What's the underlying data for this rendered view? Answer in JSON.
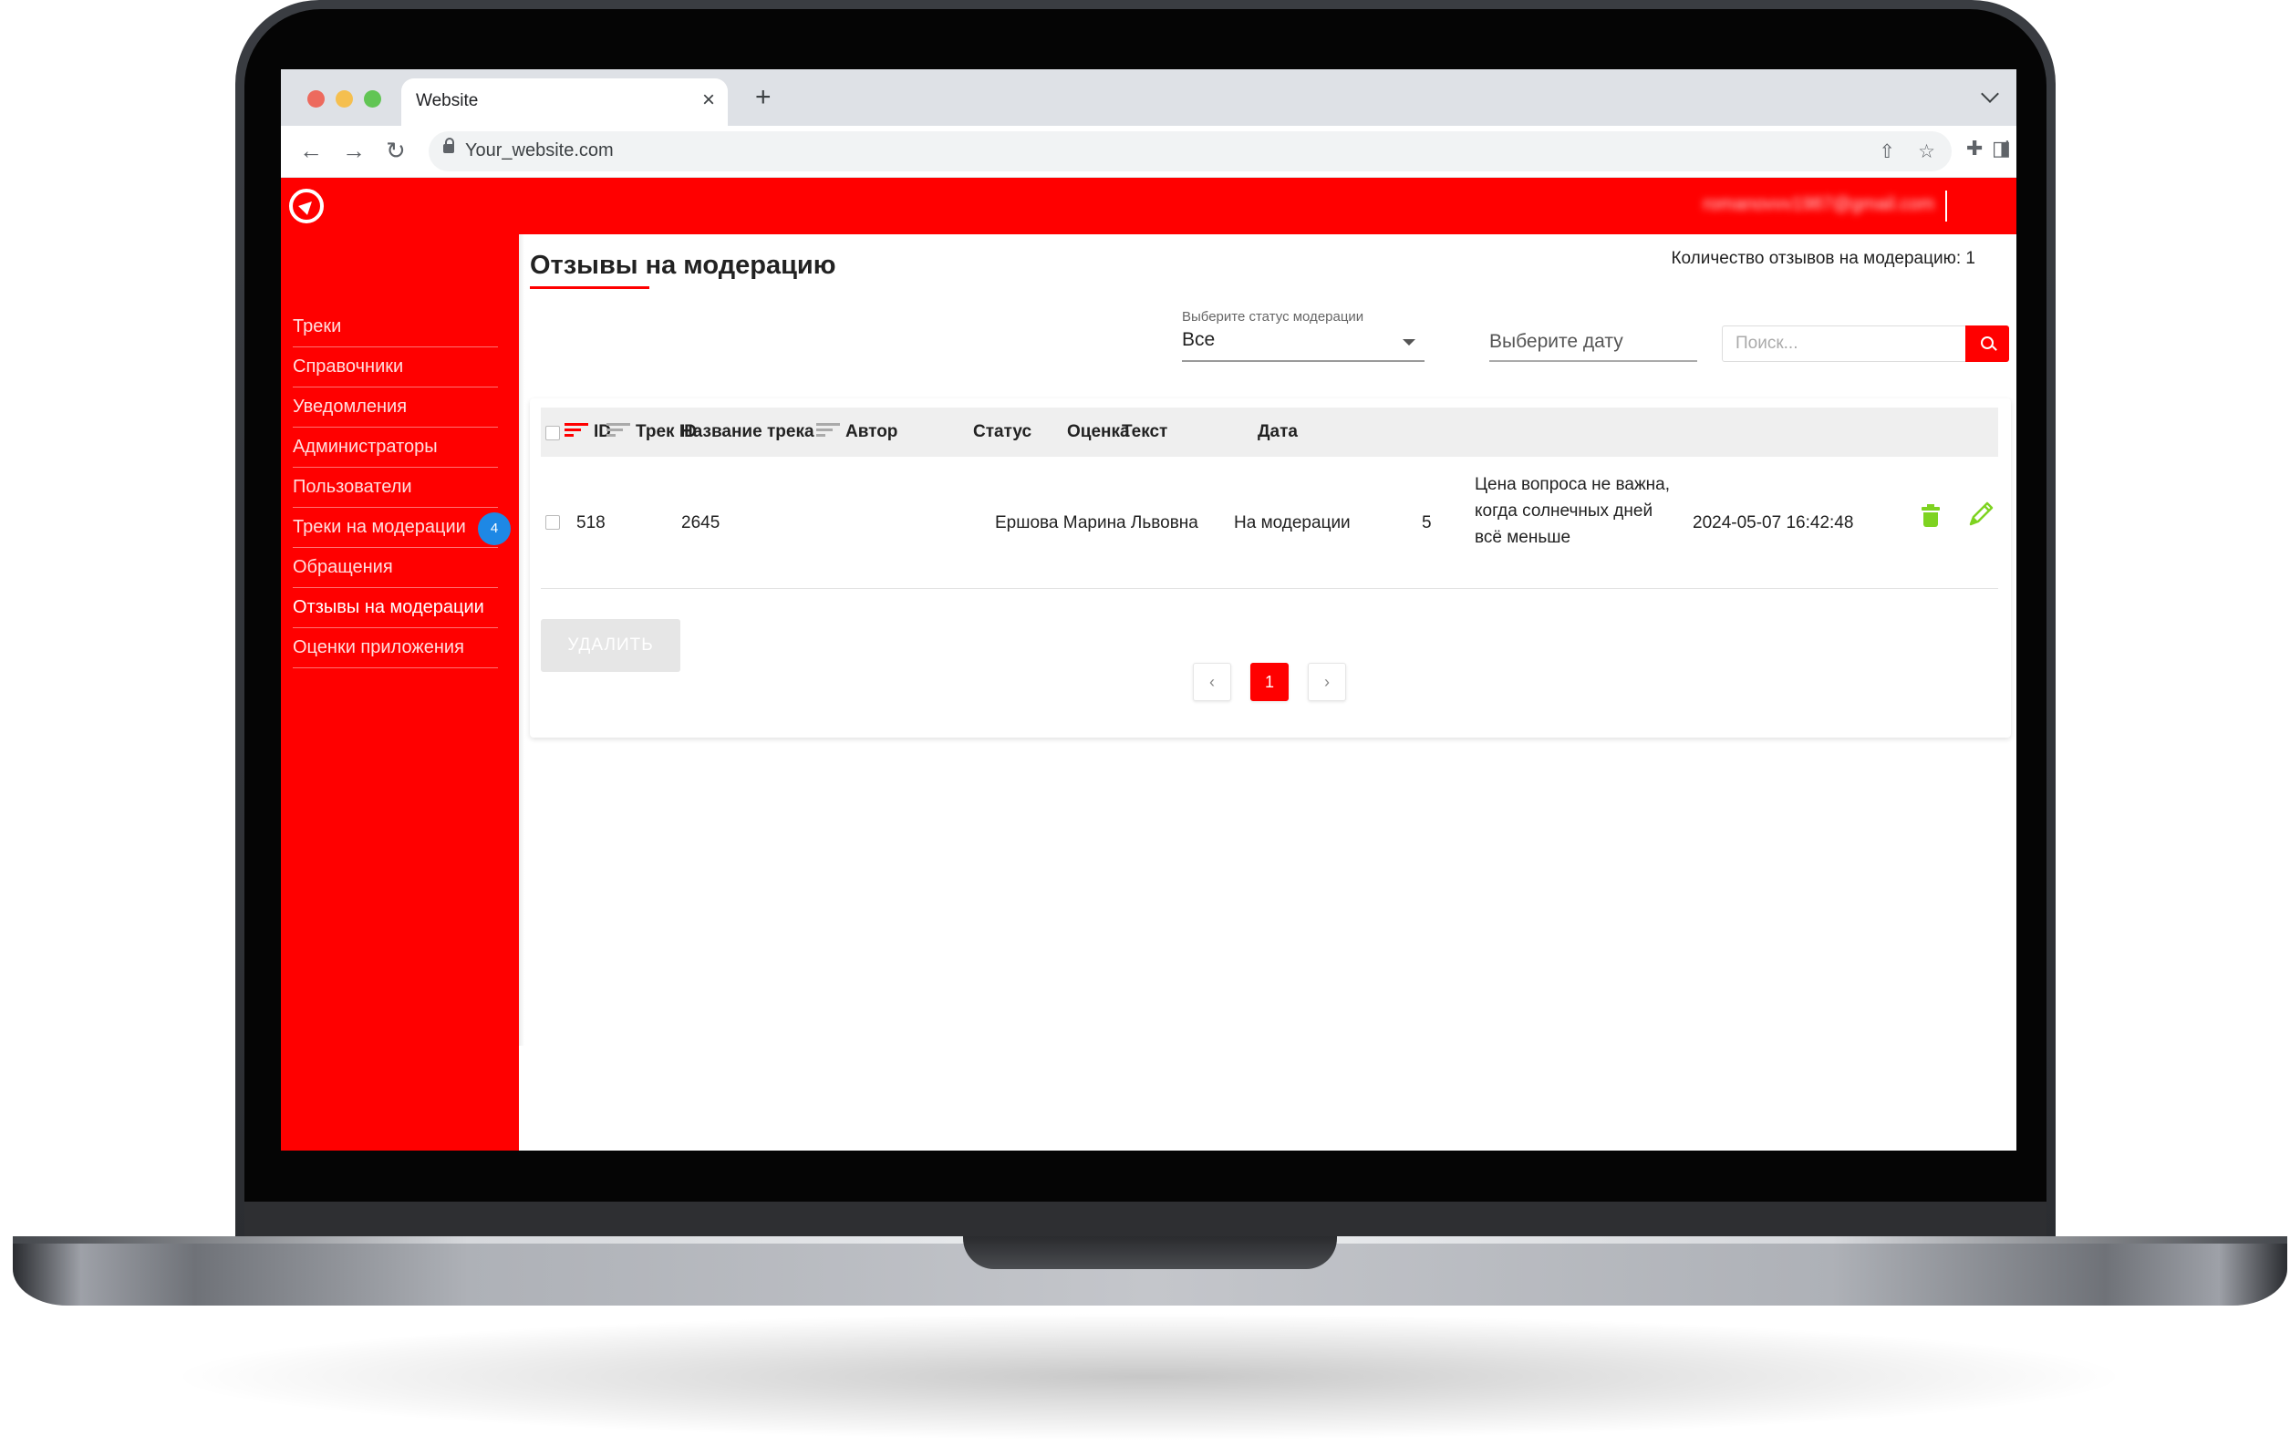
{
  "browser": {
    "tab_title": "Website",
    "tab_close": "×",
    "new_tab": "+",
    "url": "Your_website.com",
    "back": "←",
    "forward": "→",
    "reload": "↻",
    "share": "⇧",
    "star": "☆",
    "extensions": "✚",
    "sidepanel": "◨",
    "menu": "⋮"
  },
  "header": {
    "user_email": "romanovvv1987@gmail.com"
  },
  "sidebar": {
    "items": [
      {
        "label": "Треки"
      },
      {
        "label": "Справочники"
      },
      {
        "label": "Уведомления"
      },
      {
        "label": "Администраторы"
      },
      {
        "label": "Пользователи"
      },
      {
        "label": "Треки на модерации",
        "badge": "4"
      },
      {
        "label": "Обращения"
      },
      {
        "label": "Отзывы на модерации"
      },
      {
        "label": "Оценки приложения"
      }
    ],
    "active_index": 7
  },
  "page": {
    "title": "Отзывы на модерацию",
    "count_label": "Количество отзывов на модерацию: 1"
  },
  "filters": {
    "status_label": "Выберите статус модерации",
    "status_value": "Все",
    "date_placeholder": "Выберите дату",
    "search_placeholder": "Поиск..."
  },
  "table": {
    "columns": [
      "ID",
      "Трек ID",
      "Название трека",
      "Автор",
      "Статус",
      "Оценка",
      "Текст",
      "Дата"
    ],
    "rows": [
      {
        "id": "518",
        "track_id": "2645",
        "track_name": "",
        "author": "Ершова Марина Львовна",
        "status": "На модерации",
        "rating": "5",
        "text": "Цена вопроса не важна, когда солнечных дней всё меньше",
        "date": "2024-05-07 16:42:48"
      }
    ]
  },
  "actions": {
    "delete_label": "УДАЛИТЬ"
  },
  "pagination": {
    "prev": "‹",
    "current": "1",
    "next": "›"
  },
  "colors": {
    "brand": "#ff0000",
    "badge": "#1e88e5",
    "action_icons": "#7ed321"
  }
}
